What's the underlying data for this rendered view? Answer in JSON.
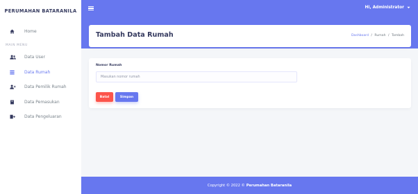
{
  "sidebar": {
    "brand": "PERUMAHAN BATARANILA",
    "home_label": "Home",
    "section_header": "MAIN MENU",
    "items": [
      {
        "label": "Data User",
        "icon": "users-icon"
      },
      {
        "label": "Data Rumah",
        "icon": "list-icon",
        "active": true
      },
      {
        "label": "Data Pemilik Rumah",
        "icon": "user-plus-icon"
      },
      {
        "label": "Data Pemasukan",
        "icon": "book-icon"
      },
      {
        "label": "Data Pengeluaran",
        "icon": "export-icon"
      }
    ]
  },
  "topbar": {
    "user_greeting": "Hi, Administrator",
    "accent_color": "#6777ef"
  },
  "header": {
    "title": "Tambah Data Rumah",
    "breadcrumb": [
      "Dashboard",
      "Rumah",
      "Tambah"
    ]
  },
  "form": {
    "field_label": "Nomor Rumah",
    "placeholder": "Masukan nomor rumah",
    "value": "",
    "cancel_label": "Batal",
    "save_label": "Simpan",
    "danger_color": "#fc544b"
  },
  "footer": {
    "prefix": "Copyright © 2022 ©",
    "owner": "Perumahan Bataranila"
  }
}
